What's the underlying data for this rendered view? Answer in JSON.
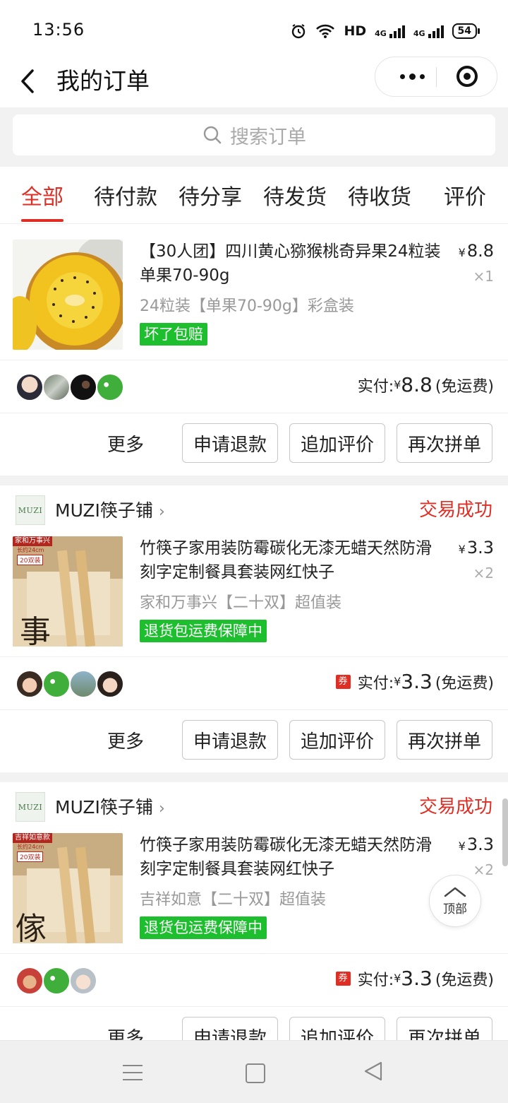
{
  "status_bar": {
    "time": "13:56",
    "network_hd": "HD",
    "net1": "4G",
    "net2": "4G",
    "battery": "54"
  },
  "header": {
    "title": "我的订单"
  },
  "search": {
    "placeholder": "搜索订单"
  },
  "tabs": [
    {
      "label": "全部",
      "active": true
    },
    {
      "label": "待付款"
    },
    {
      "label": "待分享"
    },
    {
      "label": "待发货"
    },
    {
      "label": "待收货"
    },
    {
      "label": "评价"
    }
  ],
  "orders": [
    {
      "title": "【30人团】四川黄心猕猴桃奇异果24粒装单果70-90g",
      "spec": "24粒装【单果70-90g】彩盒装",
      "badge": "坏了包赔",
      "price": "8.8",
      "qty": "×1",
      "pay_label": "实付:",
      "pay_amount": "8.8",
      "shipping": "(免运费)",
      "btn_more": "更多",
      "btn_refund": "申请退款",
      "btn_review": "追加评价",
      "btn_regroup": "再次拼单"
    },
    {
      "shop_logo": "MUZI",
      "shop_name": "MUZI筷子铺",
      "status": "交易成功",
      "title": "竹筷子家用装防霉碳化无漆无蜡天然防滑刻字定制餐具套装网红快子",
      "spec": "家和万事兴【二十双】超值装",
      "badge": "退货包运费保障中",
      "price": "3.3",
      "qty": "×2",
      "coupon": "券",
      "pay_label": "实付:",
      "pay_amount": "3.3",
      "shipping": "(免运费)",
      "btn_more": "更多",
      "btn_refund": "申请退款",
      "btn_review": "追加评价",
      "btn_regroup": "再次拼单",
      "thumb_tag": "家和万事兴",
      "thumb_sub": "长约24cm",
      "thumb_pack": "20双装"
    },
    {
      "shop_logo": "MUZI",
      "shop_name": "MUZI筷子铺",
      "status": "交易成功",
      "title": "竹筷子家用装防霉碳化无漆无蜡天然防滑刻字定制餐具套装网红快子",
      "spec": "吉祥如意【二十双】超值装",
      "badge": "退货包运费保障中",
      "price": "3.3",
      "qty": "×2",
      "coupon": "券",
      "pay_label": "实付:",
      "pay_amount": "3.3",
      "shipping": "(免运费)",
      "btn_more": "更多",
      "btn_refund": "申请退款",
      "btn_review": "追加评价",
      "btn_regroup": "再次拼单",
      "thumb_tag": "吉祥如意款",
      "thumb_sub": "长约24cm",
      "thumb_pack": "20双装"
    }
  ],
  "currency": "¥",
  "to_top": {
    "label": "顶部"
  },
  "colors": {
    "accent": "#e02e24",
    "badge_green": "#1dbf2f"
  },
  "icons": [
    "back-arrow-icon",
    "more-dots-icon",
    "target-icon",
    "search-icon",
    "chevron-right-icon",
    "chevron-up-icon",
    "menu-icon",
    "home-icon",
    "nav-back-icon"
  ]
}
